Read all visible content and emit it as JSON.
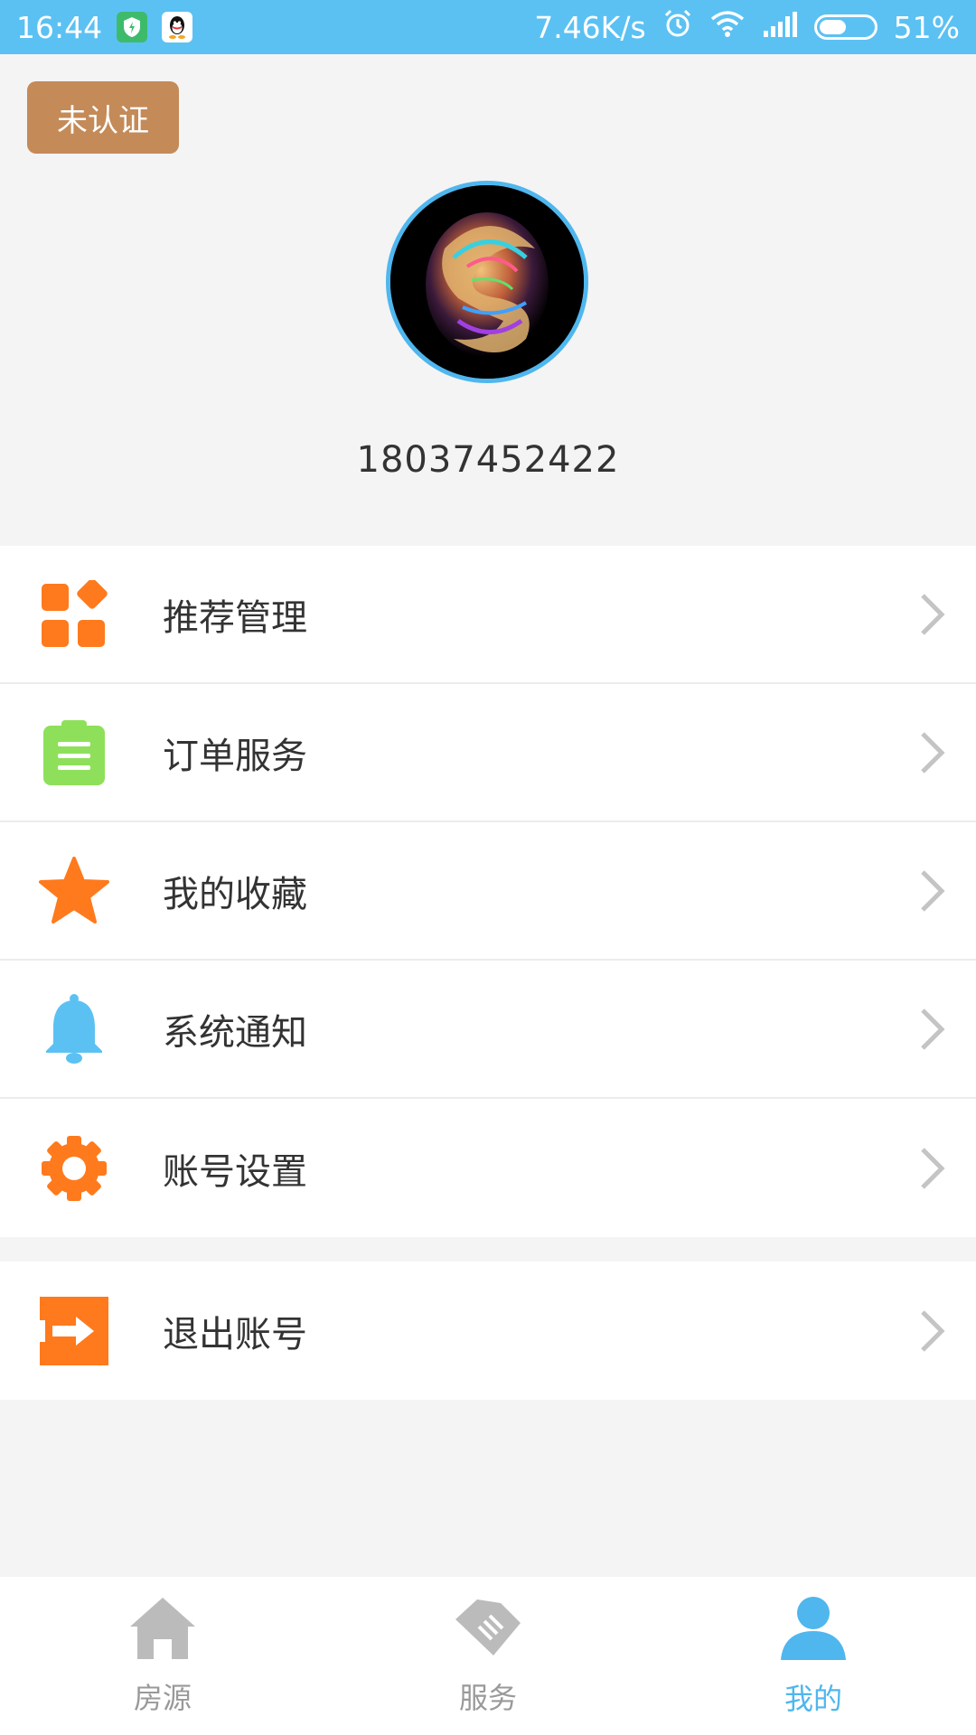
{
  "status_bar": {
    "time": "16:44",
    "network_speed": "7.46K/s",
    "battery_percent": "51%",
    "battery_level": 0.51,
    "icons": [
      "shield-app-icon",
      "qq-icon",
      "alarm-icon",
      "wifi-icon",
      "signal-icon",
      "battery-icon"
    ]
  },
  "profile": {
    "badge_label": "未认证",
    "phone": "18037452422"
  },
  "menu": {
    "items": [
      {
        "label": "推荐管理",
        "icon": "grid-icon",
        "color": "#ff7a1c"
      },
      {
        "label": "订单服务",
        "icon": "clipboard-icon",
        "color": "#8ee05a"
      },
      {
        "label": "我的收藏",
        "icon": "star-icon",
        "color": "#ff7a1c"
      },
      {
        "label": "系统通知",
        "icon": "bell-icon",
        "color": "#5bc1f3"
      },
      {
        "label": "账号设置",
        "icon": "gear-icon",
        "color": "#ff7a1c"
      }
    ],
    "logout": {
      "label": "退出账号",
      "icon": "logout-icon",
      "color": "#ff7a1c"
    }
  },
  "tabbar": {
    "tabs": [
      {
        "label": "房源",
        "icon": "house-icon",
        "active": false
      },
      {
        "label": "服务",
        "icon": "handshake-icon",
        "active": false
      },
      {
        "label": "我的",
        "icon": "person-icon",
        "active": true
      }
    ],
    "active_color": "#4fb6ee",
    "inactive_color": "#bbbbbb"
  }
}
